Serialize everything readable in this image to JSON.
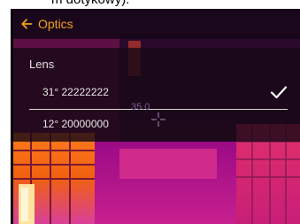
{
  "caption": {
    "text": "m dotykowy)."
  },
  "header": {
    "title": "Optics",
    "back_icon": "arrow-left-icon"
  },
  "section": {
    "label": "Lens"
  },
  "lenses": [
    {
      "label": "31° 22222222",
      "selected": true
    },
    {
      "label": "12° 20000000",
      "selected": false
    }
  ],
  "measurement": {
    "spot_value": "35.0"
  },
  "colors": {
    "accent": "#f5a01a",
    "check": "#ffffff",
    "panel_bg": "#180816"
  }
}
